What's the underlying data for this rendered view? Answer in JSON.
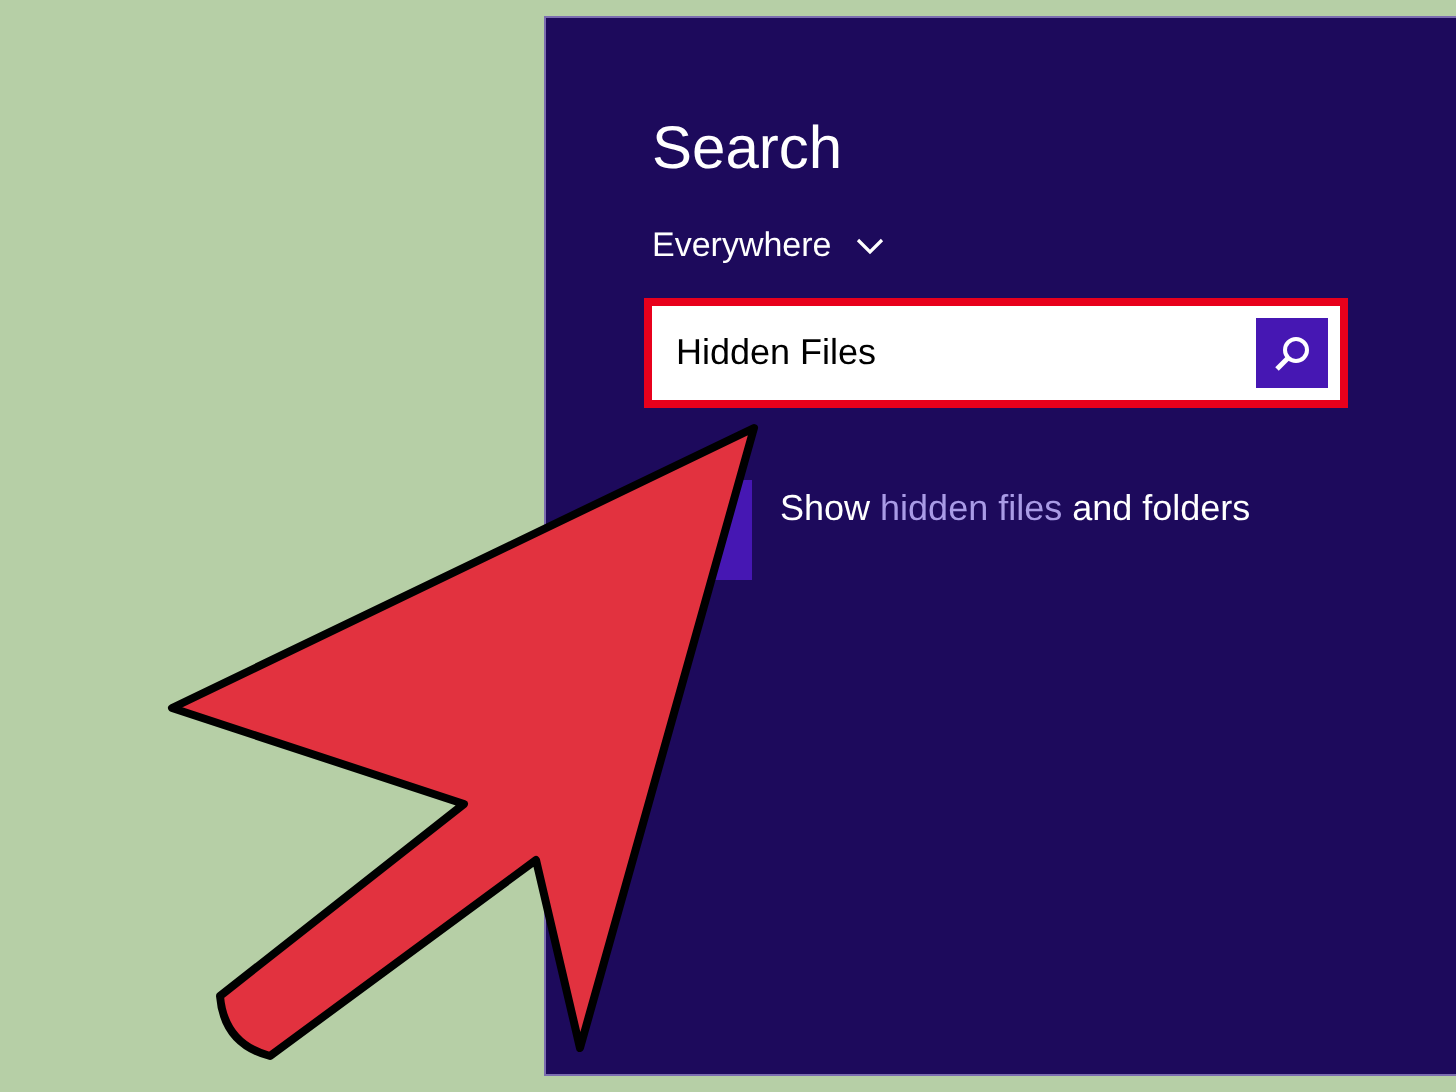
{
  "charm": {
    "title": "Search",
    "scope": "Everywhere",
    "search": {
      "value": "Hidden Files"
    },
    "results": [
      {
        "before": "Show",
        "highlight": "hidden files",
        "after": "and folders"
      }
    ]
  }
}
